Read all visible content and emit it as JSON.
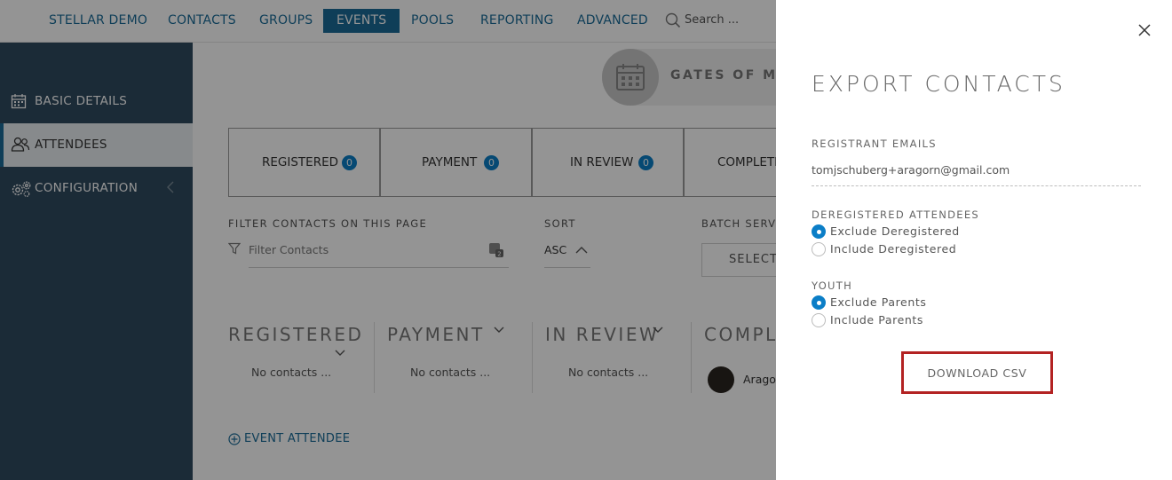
{
  "nav": {
    "items": [
      {
        "label": "STELLAR DEMO",
        "active": false
      },
      {
        "label": "CONTACTS",
        "active": false
      },
      {
        "label": "GROUPS",
        "active": false
      },
      {
        "label": "EVENTS",
        "active": true
      },
      {
        "label": "POOLS",
        "active": false
      },
      {
        "label": "REPORTING",
        "active": false
      },
      {
        "label": "ADVANCED",
        "active": false
      }
    ],
    "search_placeholder": "Search ..."
  },
  "sidebar": {
    "items": [
      {
        "label": "BASIC DETAILS",
        "icon": "calendar-icon",
        "active": false
      },
      {
        "label": "ATTENDEES",
        "icon": "users-icon",
        "active": true
      },
      {
        "label": "CONFIGURATION",
        "icon": "gears-icon",
        "active": false
      }
    ]
  },
  "event": {
    "name": "GATES OF MO"
  },
  "stat_tabs": [
    {
      "label": "REGISTERED",
      "count": "0"
    },
    {
      "label": "PAYMENT",
      "count": "0"
    },
    {
      "label": "IN REVIEW",
      "count": "0"
    },
    {
      "label": "COMPLETE",
      "count": ""
    }
  ],
  "filter": {
    "caption": "FILTER CONTACTS ON THIS PAGE",
    "placeholder": "Filter Contacts"
  },
  "sort": {
    "caption": "SORT",
    "value": "ASC"
  },
  "batch": {
    "caption": "BATCH SERVIC",
    "select_label": "SELECT A"
  },
  "columns": [
    {
      "title": "REGISTERED",
      "empty": "No contacts ..."
    },
    {
      "title": "PAYMENT",
      "empty": "No contacts ..."
    },
    {
      "title": "IN REVIEW",
      "empty": "No contacts ..."
    },
    {
      "title": "COMPLE",
      "empty": ""
    }
  ],
  "complete_contact": {
    "name": "Arago"
  },
  "add_attendee": "EVENT ATTENDEE",
  "panel": {
    "title": "EXPORT CONTACTS",
    "emails_caption": "REGISTRANT EMAILS",
    "emails_value": "tomjschuberg+aragorn@gmail.com",
    "deregistered_caption": "DEREGISTERED ATTENDEES",
    "deregistered_options": [
      {
        "label": "Exclude Deregistered",
        "selected": true
      },
      {
        "label": "Include Deregistered",
        "selected": false
      }
    ],
    "youth_caption": "YOUTH",
    "youth_options": [
      {
        "label": "Exclude Parents",
        "selected": true
      },
      {
        "label": "Include Parents",
        "selected": false
      }
    ],
    "download_label": "DOWNLOAD CSV"
  },
  "colors": {
    "accent": "#1a6c98",
    "badge": "#0b7ec7",
    "sidebar_bg": "#2f4a5f",
    "highlight": "#b32222"
  }
}
